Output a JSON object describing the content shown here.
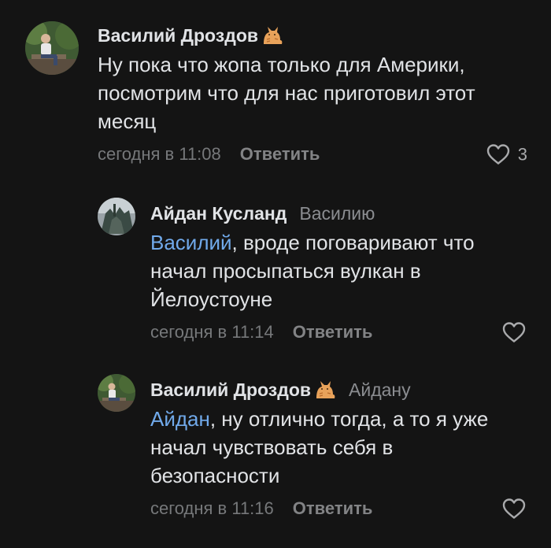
{
  "colors": {
    "background": "#141414",
    "text": "#e1e3e6",
    "secondary": "#76787a",
    "mention": "#71aaeb"
  },
  "comments": [
    {
      "author": "Василий Дроздов",
      "emoji_icon": "cat-emoji-icon",
      "reply_to": "",
      "mention": "",
      "text": "Ну пока что жопа только для Америки, посмотрим что для нас приготовил этот месяц",
      "time": "сегодня в 11:08",
      "reply_label": "Ответить",
      "likes": "3"
    },
    {
      "author": "Айдан Кусланд",
      "emoji_icon": "",
      "reply_to": "Василию",
      "mention": "Василий",
      "text": ", вроде поговаривают что начал просыпаться вулкан в Йелоустоуне",
      "time": "сегодня в 11:14",
      "reply_label": "Ответить",
      "likes": ""
    },
    {
      "author": "Василий Дроздов",
      "emoji_icon": "cat-emoji-icon",
      "reply_to": "Айдану",
      "mention": "Айдан",
      "text": ", ну отлично тогда, а то я уже начал чувствовать себя в безопасности",
      "time": "сегодня в 11:16",
      "reply_label": "Ответить",
      "likes": ""
    }
  ]
}
